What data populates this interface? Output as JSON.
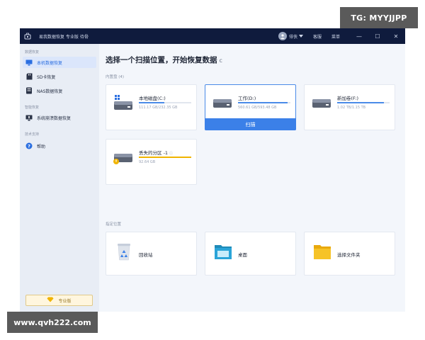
{
  "window": {
    "title": "易我数据恢复 专业版 待骨",
    "user": "俳侠",
    "links": [
      "客服",
      "菜单"
    ],
    "controls": {
      "minimize": "—",
      "maximize": "☐",
      "close": "✕"
    }
  },
  "sidebar": {
    "groups": [
      "数据恢复",
      "智能恢复",
      "技术支持"
    ],
    "items": [
      {
        "label": "本机数据恢复",
        "icon": "monitor-icon",
        "active": true
      },
      {
        "label": "SD卡恢复",
        "icon": "sd-card-icon"
      },
      {
        "label": "NAS数据恢复",
        "icon": "nas-icon"
      },
      {
        "label": "系统崩溃数据恢复",
        "icon": "system-crash-icon"
      },
      {
        "label": "帮助",
        "icon": "help-icon"
      }
    ],
    "pro_button": "专业版"
  },
  "main": {
    "title": "选择一个扫描位置，开始恢复数据",
    "refresh_icon": "c",
    "drives_section": "内置盘",
    "drives_count": "(4)",
    "drives": [
      {
        "name": "本地磁盘(C:)",
        "size": "111.17 GB/232.35 GB",
        "used_fraction": 0.48
      },
      {
        "name": "工作(D:)",
        "size": "560.61 GB/593.48 GB",
        "used_fraction": 0.94,
        "selected": true,
        "action": "扫描"
      },
      {
        "name": "新加卷(F:)",
        "size": "1.02 TB/1.15 TB",
        "used_fraction": 0.89
      },
      {
        "name": "丢失的分区 -1",
        "size": "92.64 GB",
        "used_fraction": 1.0,
        "lost": true
      }
    ],
    "locations_section": "指定位置",
    "locations": [
      {
        "name": "回收站",
        "icon": "recycle-bin-icon"
      },
      {
        "name": "桌面",
        "icon": "desktop-icon"
      },
      {
        "name": "选择文件夹",
        "icon": "folder-icon"
      }
    ]
  },
  "watermarks": {
    "top": "TG: MYYJJPP",
    "bottom": "www.qvh222.com"
  },
  "colors": {
    "titlebar": "#0f1b3d",
    "accent": "#3b80e8",
    "lost_partition": "#f0b400"
  }
}
